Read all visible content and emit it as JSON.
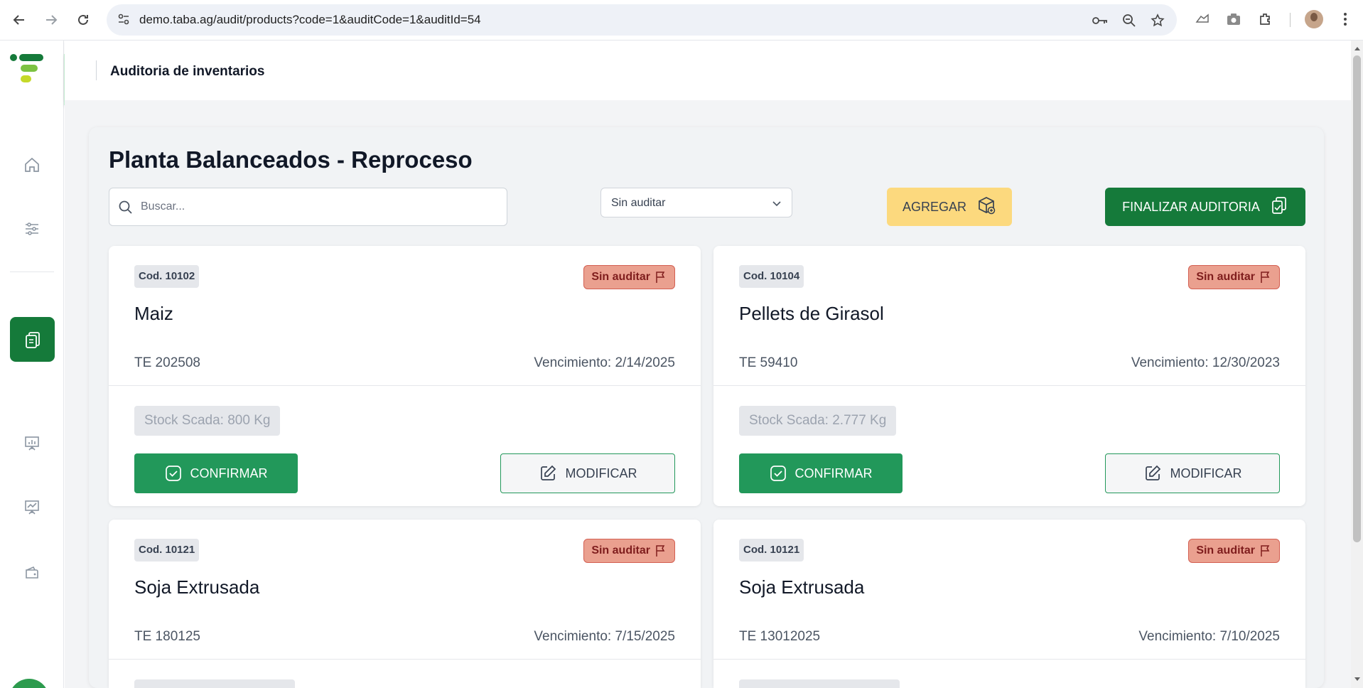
{
  "browser": {
    "url": "demo.taba.ag/audit/products?code=1&auditCode=1&auditId=54"
  },
  "app": {
    "header_title": "Auditoria de inventarios",
    "brand_colors": {
      "primary": "#157a3a",
      "accent": "#fcd97e",
      "status_bg": "#eaa08f"
    }
  },
  "sidebar": {
    "items": [
      {
        "name": "home-icon"
      },
      {
        "name": "sliders-icon"
      },
      {
        "name": "audit-clipboard-icon",
        "active": true
      },
      {
        "name": "presentation-chart-icon"
      },
      {
        "name": "trend-chart-icon"
      },
      {
        "name": "wallet-icon"
      }
    ]
  },
  "page": {
    "title": "Planta Balanceados - Reproceso",
    "search_placeholder": "Buscar...",
    "filter_value": "Sin auditar",
    "add_label": "AGREGAR",
    "finalize_label": "FINALIZAR AUDITORIA"
  },
  "cards": [
    {
      "code": "Cod. 10102",
      "status": "Sin auditar",
      "name": "Maiz",
      "lot": "TE 202508",
      "expiry": "Vencimiento: 2/14/2025",
      "stock": "Stock Scada: 800 Kg",
      "confirm": "CONFIRMAR",
      "modify": "MODIFICAR"
    },
    {
      "code": "Cod. 10104",
      "status": "Sin auditar",
      "name": "Pellets de Girasol",
      "lot": "TE 59410",
      "expiry": "Vencimiento: 12/30/2023",
      "stock": "Stock Scada: 2.777 Kg",
      "confirm": "CONFIRMAR",
      "modify": "MODIFICAR"
    },
    {
      "code": "Cod. 10121",
      "status": "Sin auditar",
      "name": "Soja Extrusada",
      "lot": "TE 180125",
      "expiry": "Vencimiento: 7/15/2025"
    },
    {
      "code": "Cod. 10121",
      "status": "Sin auditar",
      "name": "Soja Extrusada",
      "lot": "TE 13012025",
      "expiry": "Vencimiento: 7/10/2025"
    }
  ]
}
